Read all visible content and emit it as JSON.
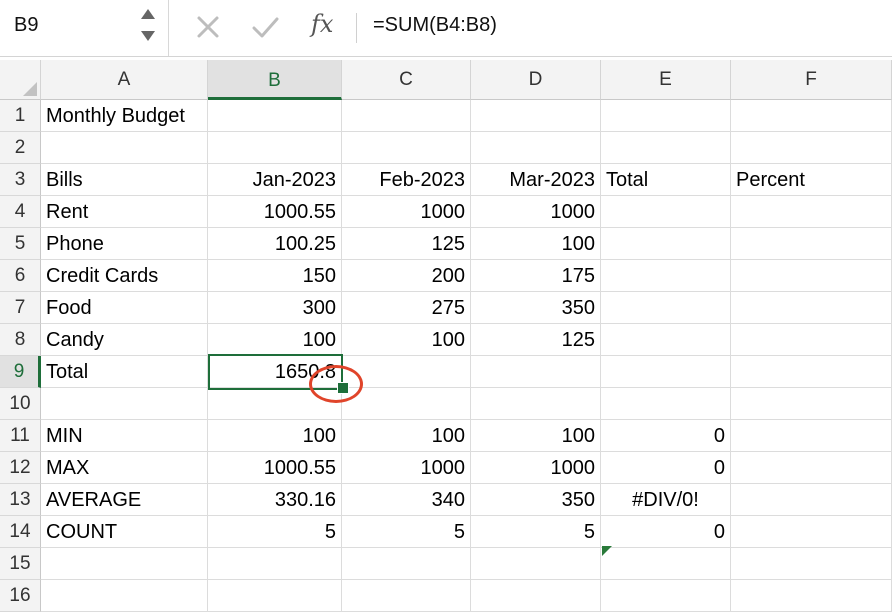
{
  "formula_bar": {
    "name_box": "B9",
    "cancel_icon": "close-icon",
    "enter_icon": "check-icon",
    "function_symbol": "fx",
    "formula": "=SUM(B4:B8)"
  },
  "selection": {
    "cell": "B9",
    "column": "B",
    "row": "9"
  },
  "columns": [
    "A",
    "B",
    "C",
    "D",
    "E",
    "F"
  ],
  "rows": [
    {
      "num": "1",
      "cells": [
        "Monthly Budget",
        "",
        "",
        "",
        "",
        ""
      ]
    },
    {
      "num": "2",
      "cells": [
        "",
        "",
        "",
        "",
        "",
        ""
      ]
    },
    {
      "num": "3",
      "cells": [
        "Bills",
        "Jan-2023",
        "Feb-2023",
        "Mar-2023",
        "Total",
        "Percent"
      ]
    },
    {
      "num": "4",
      "cells": [
        "Rent",
        "1000.55",
        "1000",
        "1000",
        "",
        ""
      ]
    },
    {
      "num": "5",
      "cells": [
        "Phone",
        "100.25",
        "125",
        "100",
        "",
        ""
      ]
    },
    {
      "num": "6",
      "cells": [
        "Credit Cards",
        "150",
        "200",
        "175",
        "",
        ""
      ]
    },
    {
      "num": "7",
      "cells": [
        "Food",
        "300",
        "275",
        "350",
        "",
        ""
      ]
    },
    {
      "num": "8",
      "cells": [
        "Candy",
        "100",
        "100",
        "125",
        "",
        ""
      ]
    },
    {
      "num": "9",
      "cells": [
        "Total",
        "1650.8",
        "",
        "",
        "",
        ""
      ]
    },
    {
      "num": "10",
      "cells": [
        "",
        "",
        "",
        "",
        "",
        ""
      ]
    },
    {
      "num": "11",
      "cells": [
        "MIN",
        "100",
        "100",
        "100",
        "0",
        ""
      ]
    },
    {
      "num": "12",
      "cells": [
        "MAX",
        "1000.55",
        "1000",
        "1000",
        "0",
        ""
      ]
    },
    {
      "num": "13",
      "cells": [
        "AVERAGE",
        "330.16",
        "340",
        "350",
        "#DIV/0!",
        ""
      ]
    },
    {
      "num": "14",
      "cells": [
        "COUNT",
        "5",
        "5",
        "5",
        "0",
        ""
      ]
    },
    {
      "num": "15",
      "cells": [
        "",
        "",
        "",
        "",
        "",
        ""
      ]
    },
    {
      "num": "16",
      "cells": [
        "",
        "",
        "",
        "",
        "",
        ""
      ]
    }
  ],
  "colors": {
    "selection": "#1e6e3a",
    "annotation": "#e0442a"
  }
}
